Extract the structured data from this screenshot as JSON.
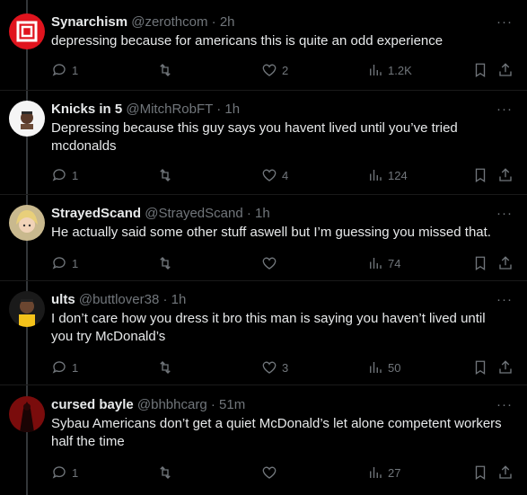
{
  "replies": [
    {
      "name": "Synarchism",
      "handle": "@zerothcom",
      "time": "2h",
      "text": "depressing because for americans this is quite an odd experience",
      "replies": "1",
      "likes": "2",
      "views": "1.2K"
    },
    {
      "name": "Knicks in 5",
      "handle": "@MitchRobFT",
      "time": "1h",
      "text": "Depressing because this guy says you havent lived until you’ve tried mcdonalds",
      "replies": "1",
      "likes": "4",
      "views": "124"
    },
    {
      "name": "StrayedScand",
      "handle": "@StrayedScand",
      "time": "1h",
      "text": "He actually said some other stuff aswell but I’m guessing you missed that.",
      "replies": "1",
      "likes": "",
      "views": "74"
    },
    {
      "name": "ults",
      "handle": "@buttlover38",
      "time": "1h",
      "text": "I don’t care how you dress it bro this man is saying you haven’t lived until you try McDonald’s",
      "replies": "1",
      "likes": "3",
      "views": "50"
    },
    {
      "name": "cursed bayle",
      "handle": "@bhbhcarg",
      "time": "51m",
      "text": "Sybau Americans don’t get a quiet McDonald’s let alone competent workers half the time",
      "replies": "1",
      "likes": "",
      "views": "27"
    }
  ],
  "ui": {
    "separator": "·",
    "more": "···"
  },
  "icons": {
    "reply": "reply-icon",
    "retweet": "retweet-icon",
    "like": "heart-icon",
    "views": "views-icon",
    "bookmark": "bookmark-icon",
    "share": "share-icon",
    "more": "more-icon"
  },
  "colors": {
    "background": "#000000",
    "text": "#e7e9ea",
    "muted": "#71767b",
    "avatar1": "#e0141e"
  }
}
